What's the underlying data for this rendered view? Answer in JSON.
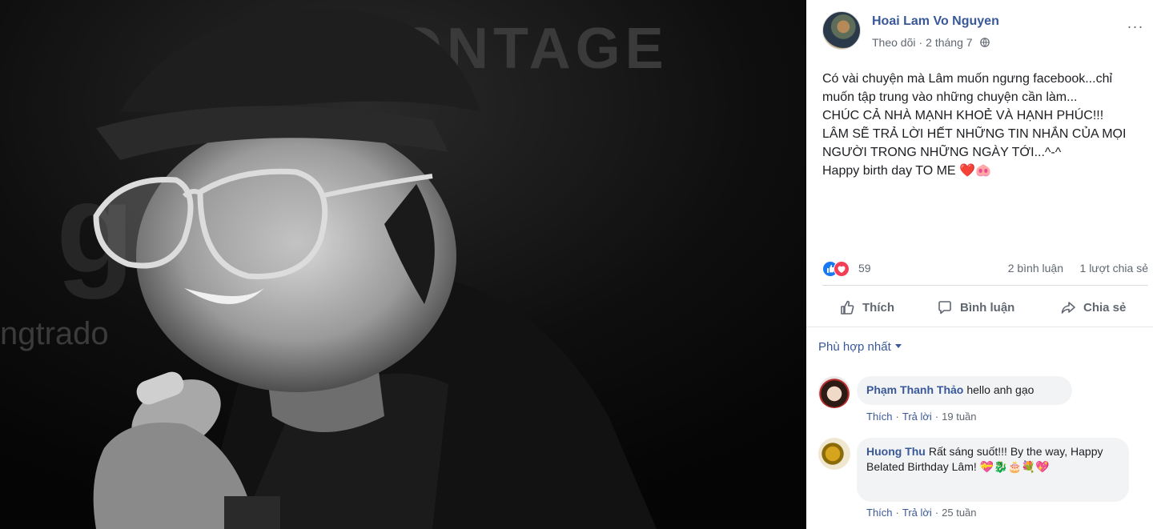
{
  "post": {
    "author": "Hoai Lam Vo Nguyen",
    "follow_label": "Theo dõi",
    "separator": "·",
    "date": "2 tháng 7",
    "privacy_icon": "globe-icon",
    "more_icon": "more-icon",
    "more_label": "···",
    "text_lines": [
      "Có vài chuyện mà Lâm muốn ngưng facebook...chỉ muốn tập trung vào những chuyện cần làm...",
      "CHÚC CẢ NHÀ MẠNH KHOẺ VÀ HẠNH PHÚC!!!",
      "LÂM SẼ TRẢ LỜI HẾT NHỮNG TIN NHẮN CỦA MỌI NGƯỜI TRONG NHỮNG NGÀY TỚI...^-^",
      "Happy birth day TO ME ❤️🐽"
    ],
    "reaction_icons": [
      "like-reaction-icon",
      "love-reaction-icon"
    ],
    "reaction_count": "59",
    "comment_count": "2 bình luận",
    "share_count": "1 lượt chia sẻ"
  },
  "actions": {
    "like": "Thích",
    "comment": "Bình luận",
    "share": "Chia sẻ"
  },
  "sort": {
    "label": "Phù hợp nhất"
  },
  "comments": [
    {
      "name": "Phạm Thanh Thảo",
      "text": "hello anh gạo",
      "like": "Thích",
      "reply": "Trả lời",
      "time": "19 tuần"
    },
    {
      "name": "Huong Thu",
      "text": "Rất sáng suốt!!! By the way, Happy Belated Birthday Lâm! 💝🐉🎂💐💖",
      "like": "Thích",
      "reply": "Trả lời",
      "time": "25 tuần"
    }
  ],
  "photo": {
    "backdrop_text": "MONTAGE",
    "side_text": "ngtrado",
    "side_glyph": "g"
  },
  "colors": {
    "link_blue": "#385898",
    "like_blue": "#1877f2",
    "love_red": "#f33e58",
    "muted": "#606770",
    "bubble_bg": "#f2f3f5"
  }
}
